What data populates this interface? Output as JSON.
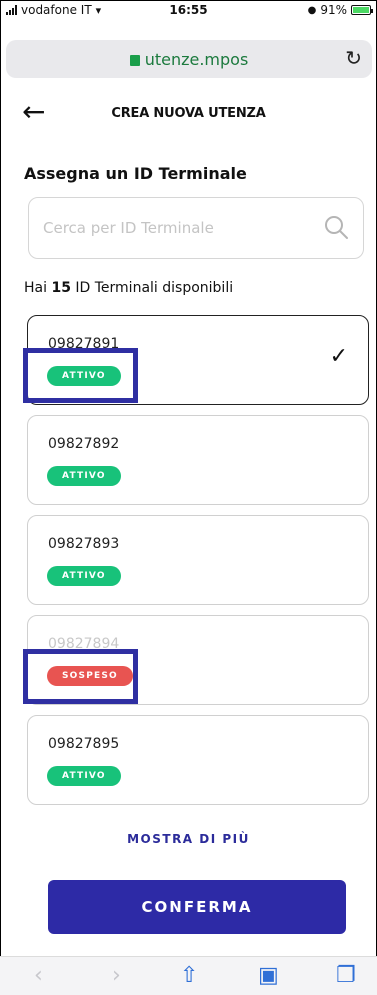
{
  "status_bar": {
    "carrier": "vodafone IT",
    "time": "16:55",
    "battery": "91%"
  },
  "browser": {
    "url": "utenze.mpos"
  },
  "header": {
    "title": "CREA NUOVA UTENZA"
  },
  "section": {
    "title": "Assegna un ID Terminale",
    "search_placeholder": "Cerca per ID Terminale",
    "available_prefix": "Hai",
    "available_count": "15",
    "available_suffix": "ID Terminali disponibili"
  },
  "terminals": [
    {
      "id": "09827891",
      "status": "ATTIVO",
      "selected": true
    },
    {
      "id": "09827892",
      "status": "ATTIVO",
      "selected": false
    },
    {
      "id": "09827893",
      "status": "ATTIVO",
      "selected": false
    },
    {
      "id": "09827894",
      "status": "SOSPESO",
      "selected": false
    },
    {
      "id": "09827895",
      "status": "ATTIVO",
      "selected": false
    }
  ],
  "show_more_label": "MOSTRA DI PIÙ",
  "confirm_label": "CONFERMA",
  "colors": {
    "primary": "#2d2aa6",
    "active_badge": "#18c27a",
    "suspended_badge": "#e85451",
    "highlight": "#2f2fa2"
  },
  "icons": {
    "back": "arrow-left-icon",
    "search": "search-icon",
    "selected": "check-icon",
    "reload": "reload-icon"
  }
}
